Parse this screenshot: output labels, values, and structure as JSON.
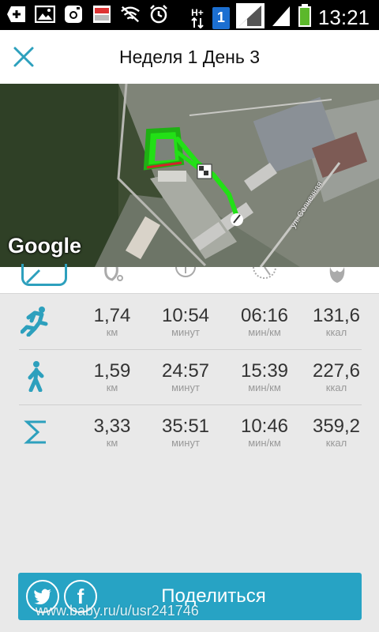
{
  "status_bar": {
    "time": "13:21",
    "sim_badge": "1",
    "network_type": "H+",
    "icons": [
      "add-icon",
      "gallery-icon",
      "instagram-icon",
      "app-icon",
      "wifi-off-icon",
      "alarm-icon",
      "network-icon",
      "sim-icon",
      "signal-icon",
      "signal-icon",
      "battery-icon"
    ]
  },
  "header": {
    "title": "Неделя 1 День 3",
    "close_icon": "close-icon"
  },
  "map": {
    "logo": "Google",
    "street": "ул. Солнечная",
    "route_color": "#22e016"
  },
  "tabs": [
    {
      "icon": "edit-icon",
      "active": true
    },
    {
      "icon": "route-icon",
      "active": false
    },
    {
      "icon": "stopwatch-icon",
      "active": false
    },
    {
      "icon": "speedometer-icon",
      "active": false
    },
    {
      "icon": "flame-icon",
      "active": false
    }
  ],
  "stats": [
    {
      "icon": "run-icon",
      "distance": "1,74",
      "distance_unit": "км",
      "duration": "10:54",
      "duration_unit": "минут",
      "pace": "06:16",
      "pace_unit": "мин/км",
      "calories": "131,6",
      "calories_unit": "ккал"
    },
    {
      "icon": "walk-icon",
      "distance": "1,59",
      "distance_unit": "км",
      "duration": "24:57",
      "duration_unit": "минут",
      "pace": "15:39",
      "pace_unit": "мин/км",
      "calories": "227,6",
      "calories_unit": "ккал"
    },
    {
      "icon": "sigma-icon",
      "distance": "3,33",
      "distance_unit": "км",
      "duration": "35:51",
      "duration_unit": "минут",
      "pace": "10:46",
      "pace_unit": "мин/км",
      "calories": "359,2",
      "calories_unit": "ккал"
    }
  ],
  "share": {
    "label": "Поделиться",
    "twitter_icon": "twitter-icon",
    "facebook_icon": "facebook-icon",
    "facebook_glyph": "f"
  },
  "watermark": "www.baby.ru/u/usr241746",
  "colors": {
    "accent": "#27a3c4",
    "icon_blue": "#2da0bd",
    "background": "#e9e9e9"
  }
}
